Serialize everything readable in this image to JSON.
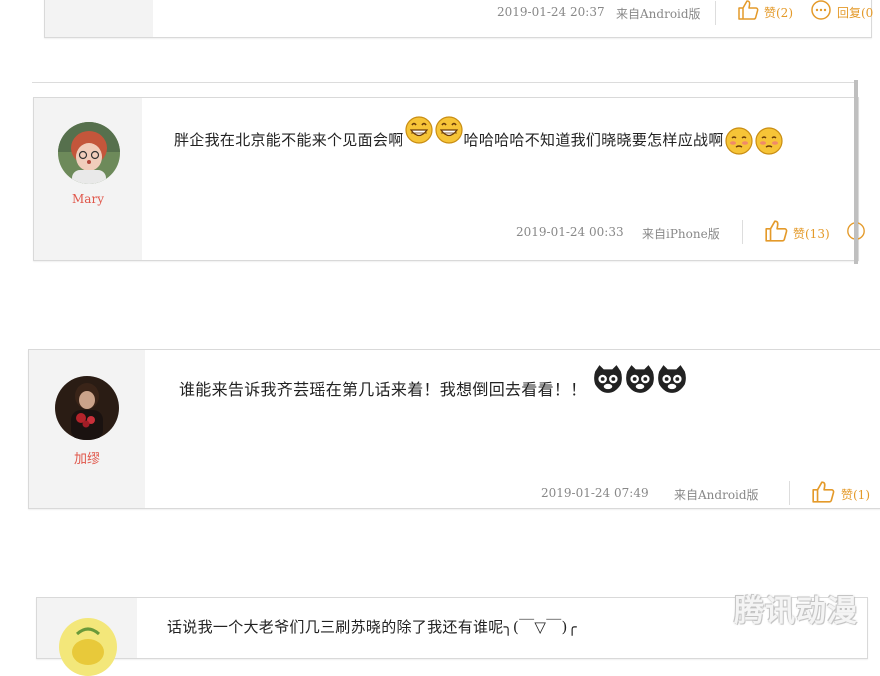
{
  "comments": [
    {
      "time": "2019-01-24 20:37",
      "source": "来自Android版",
      "likes": "赞(2)",
      "reply": "回复(0"
    },
    {
      "username": "Mary",
      "text_a": "胖企我在北京能不能来个见面会啊",
      "text_b": "哈哈哈哈不知道我们晓晓要怎样应战啊",
      "time": "2019-01-24 00:33",
      "source": "来自iPhone版",
      "likes": "赞(13)"
    },
    {
      "username": "加缪",
      "text": "谁能来告诉我齐芸瑶在第几话来着！我想倒回去看看！！",
      "time": "2019-01-24 07:49",
      "source": "来自Android版",
      "likes": "赞(1)"
    },
    {
      "text": "话说我一个大老爷们几三刷苏晓的除了我还有谁呢╮(￣▽￣)╭"
    }
  ],
  "watermark": "腾讯动漫",
  "icons": {
    "like": "thumbs-up-icon",
    "reply": "speech-bubble-icon",
    "grin_emoji": "grinning-face-icon",
    "shy_emoji": "shy-face-icon",
    "cat_emoji": "black-cat-face-icon"
  },
  "colors": {
    "username": "#e0564a",
    "like": "#e49a2a",
    "meta": "#888888"
  }
}
